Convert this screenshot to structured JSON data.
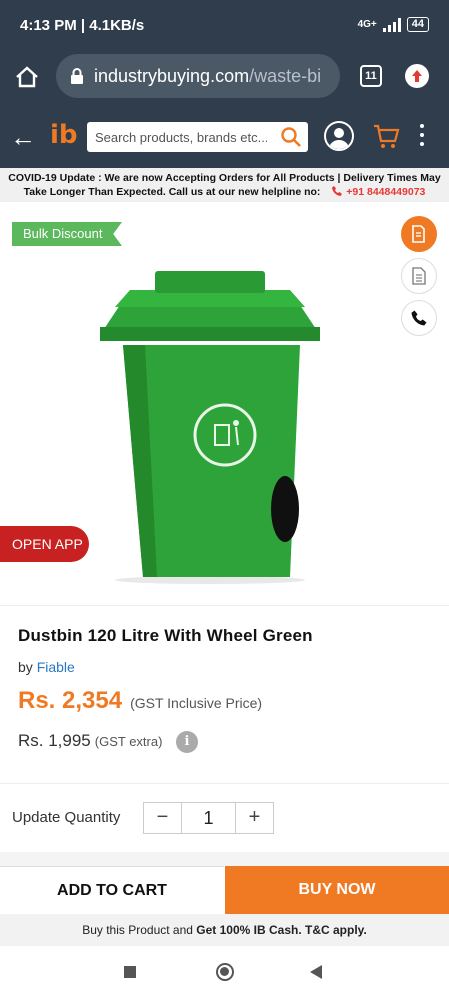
{
  "status_bar": {
    "time": "4:13 PM | 4.1KB/s",
    "network": "4G+",
    "battery": "44"
  },
  "browser": {
    "url_host": "industrybuying.com",
    "url_path": "/waste-bi",
    "tab_count": "11"
  },
  "header": {
    "logo": "ib",
    "search_placeholder": "Search products, brands etc..."
  },
  "notice": {
    "text": "COVID-19 Update : We are now Accepting Orders for All Products | Delivery Times May Take Longer Than Expected. Call us at our new helpline no:",
    "phone": "+91 8448449073"
  },
  "product": {
    "bulk_tag": "Bulk Discount",
    "open_app": "OPEN APP",
    "title": "Dustbin 120 Litre With Wheel Green",
    "by_prefix": "by",
    "brand": "Fiable",
    "price": "Rs. 2,354",
    "price_note": "(GST Inclusive Price)",
    "price_ex": "Rs. 1,995",
    "price_ex_note": "(GST extra)",
    "info_glyph": "i",
    "image_color": "#2ea33a"
  },
  "quantity": {
    "label": "Update Quantity",
    "minus": "−",
    "value": "1",
    "plus": "+"
  },
  "actions": {
    "add_to_cart": "ADD TO CART",
    "buy_now": "BUY NOW"
  },
  "cash": {
    "prefix": "Buy this Product and",
    "bold": "Get 100% IB Cash. T&C apply."
  },
  "colors": {
    "accent": "#f07a24",
    "header_bg": "#2f3d4c",
    "brand_link": "#2979c5",
    "bulk_tag": "#5cb85c",
    "open_app": "#c82121"
  }
}
